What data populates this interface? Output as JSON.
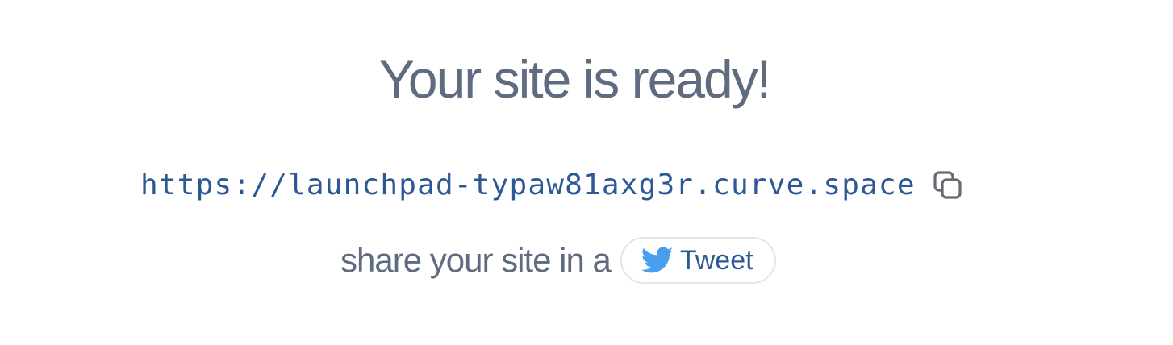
{
  "heading": "Your site is ready!",
  "site": {
    "url": "https://launchpad-typaw81axg3r.curve.space",
    "copy_icon": "copy-icon"
  },
  "share": {
    "text": "share your site in a",
    "tweet_label": "Tweet",
    "tweet_icon": "twitter-bird-icon"
  },
  "colors": {
    "heading": "#5f6b7f",
    "url": "#2c5896",
    "twitter_blue": "#4a9ef0",
    "button_border": "#e3e5e8"
  }
}
